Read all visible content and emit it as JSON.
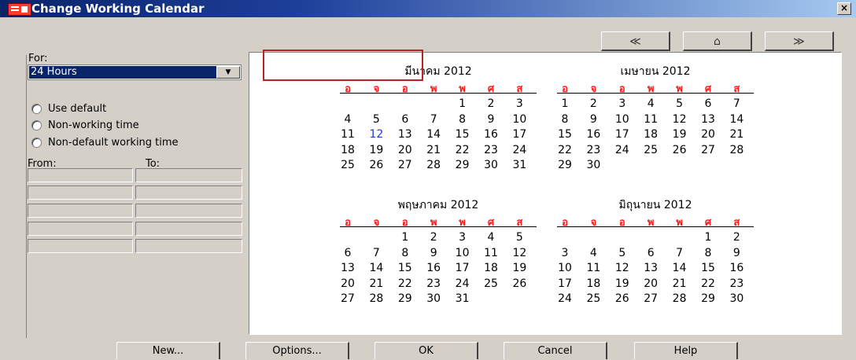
{
  "window": {
    "title": "Change Working Calendar",
    "close_label": "×"
  },
  "nav": {
    "prev": "≪",
    "home": "⌂",
    "next": "≫"
  },
  "for": {
    "label": "For:",
    "selected": "24 Hours",
    "arrow": "▼"
  },
  "options": [
    "Use default",
    "Non-working time",
    "Non-default working time"
  ],
  "times": {
    "from_label": "From:",
    "to_label": "To:"
  },
  "dow": [
    "อ",
    "จ",
    "อ",
    "พ",
    "พ",
    "ศ",
    "ส"
  ],
  "months": [
    {
      "title": "มีนาคม 2012",
      "weeks": [
        [
          "",
          "",
          "",
          "",
          "1",
          "2",
          "3"
        ],
        [
          "4",
          "5",
          "6",
          "7",
          "8",
          "9",
          "10"
        ],
        [
          "11",
          "12",
          "13",
          "14",
          "15",
          "16",
          "17"
        ],
        [
          "18",
          "19",
          "20",
          "21",
          "22",
          "23",
          "24"
        ],
        [
          "25",
          "26",
          "27",
          "28",
          "29",
          "30",
          "31"
        ]
      ],
      "today": "12"
    },
    {
      "title": "เมษายน 2012",
      "weeks": [
        [
          "1",
          "2",
          "3",
          "4",
          "5",
          "6",
          "7"
        ],
        [
          "8",
          "9",
          "10",
          "11",
          "12",
          "13",
          "14"
        ],
        [
          "15",
          "16",
          "17",
          "18",
          "19",
          "20",
          "21"
        ],
        [
          "22",
          "23",
          "24",
          "25",
          "26",
          "27",
          "28"
        ],
        [
          "29",
          "30",
          "",
          "",
          "",
          "",
          ""
        ]
      ]
    },
    {
      "title": "พฤษภาคม 2012",
      "weeks": [
        [
          "",
          "",
          "1",
          "2",
          "3",
          "4",
          "5"
        ],
        [
          "6",
          "7",
          "8",
          "9",
          "10",
          "11",
          "12"
        ],
        [
          "13",
          "14",
          "15",
          "16",
          "17",
          "18",
          "19"
        ],
        [
          "20",
          "21",
          "22",
          "23",
          "24",
          "25",
          "26"
        ],
        [
          "27",
          "28",
          "29",
          "30",
          "31",
          "",
          ""
        ]
      ]
    },
    {
      "title": "มิถุนายน 2012",
      "weeks": [
        [
          "",
          "",
          "",
          "",
          "",
          "1",
          "2"
        ],
        [
          "3",
          "4",
          "5",
          "6",
          "7",
          "8",
          "9"
        ],
        [
          "10",
          "11",
          "12",
          "13",
          "14",
          "15",
          "16"
        ],
        [
          "17",
          "18",
          "19",
          "20",
          "21",
          "22",
          "23"
        ],
        [
          "24",
          "25",
          "26",
          "27",
          "28",
          "29",
          "30"
        ]
      ]
    }
  ],
  "buttons": {
    "new": "New...",
    "options": "Options...",
    "ok": "OK",
    "cancel": "Cancel",
    "help": "Help"
  },
  "colors": {
    "weekday_header": "#ff1a1a",
    "today": "#1e3cd0",
    "selected": "#0a246a"
  }
}
